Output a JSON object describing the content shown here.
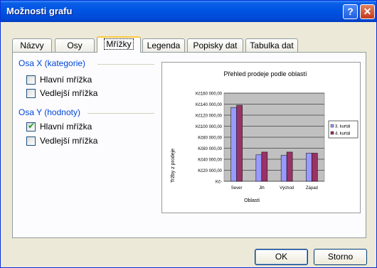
{
  "window": {
    "title": "Možnosti grafu",
    "help_label": "?",
    "close_label": "✕"
  },
  "tabs": [
    {
      "label": "Názvy"
    },
    {
      "label": "Osy"
    },
    {
      "label": "Mřížky"
    },
    {
      "label": "Legenda"
    },
    {
      "label": "Popisky dat"
    },
    {
      "label": "Tabulka dat"
    }
  ],
  "active_tab": "Mřížky",
  "x_group": {
    "label": "Osa X (kategorie)",
    "major": {
      "label": "Hlavní mřížka",
      "checked": false
    },
    "minor": {
      "label": "Vedlejší mřížka",
      "checked": false
    }
  },
  "y_group": {
    "label": "Osa Y (hodnoty)",
    "major": {
      "label": "Hlavní mřížka",
      "checked": true
    },
    "minor": {
      "label": "Vedlejší mřížka",
      "checked": false
    }
  },
  "buttons": {
    "ok": "OK",
    "cancel": "Storno"
  },
  "chart_data": {
    "type": "bar",
    "title": "Přehled prodeje podle oblastí",
    "xlabel": "Oblasti",
    "ylabel": "Tržby z prodeje",
    "categories": [
      "Sever",
      "Jih",
      "Východ",
      "Západ"
    ],
    "series": [
      {
        "name": "3. kurtál",
        "values": [
          134000,
          48000,
          47000,
          51000
        ],
        "color": "#9999ff"
      },
      {
        "name": "4. kurtál",
        "values": [
          138000,
          53000,
          53000,
          51000
        ],
        "color": "#993366"
      }
    ],
    "ylim": [
      0,
      160000
    ],
    "yticks": [
      "Kč-",
      "Kč20 000,00",
      "Kč40 000,00",
      "Kč60 000,00",
      "Kč80 000,00",
      "Kč100 000,00",
      "Kč120 000,00",
      "Kč140 000,00",
      "Kč160 000,00"
    ],
    "grid": true,
    "legend": "right"
  }
}
